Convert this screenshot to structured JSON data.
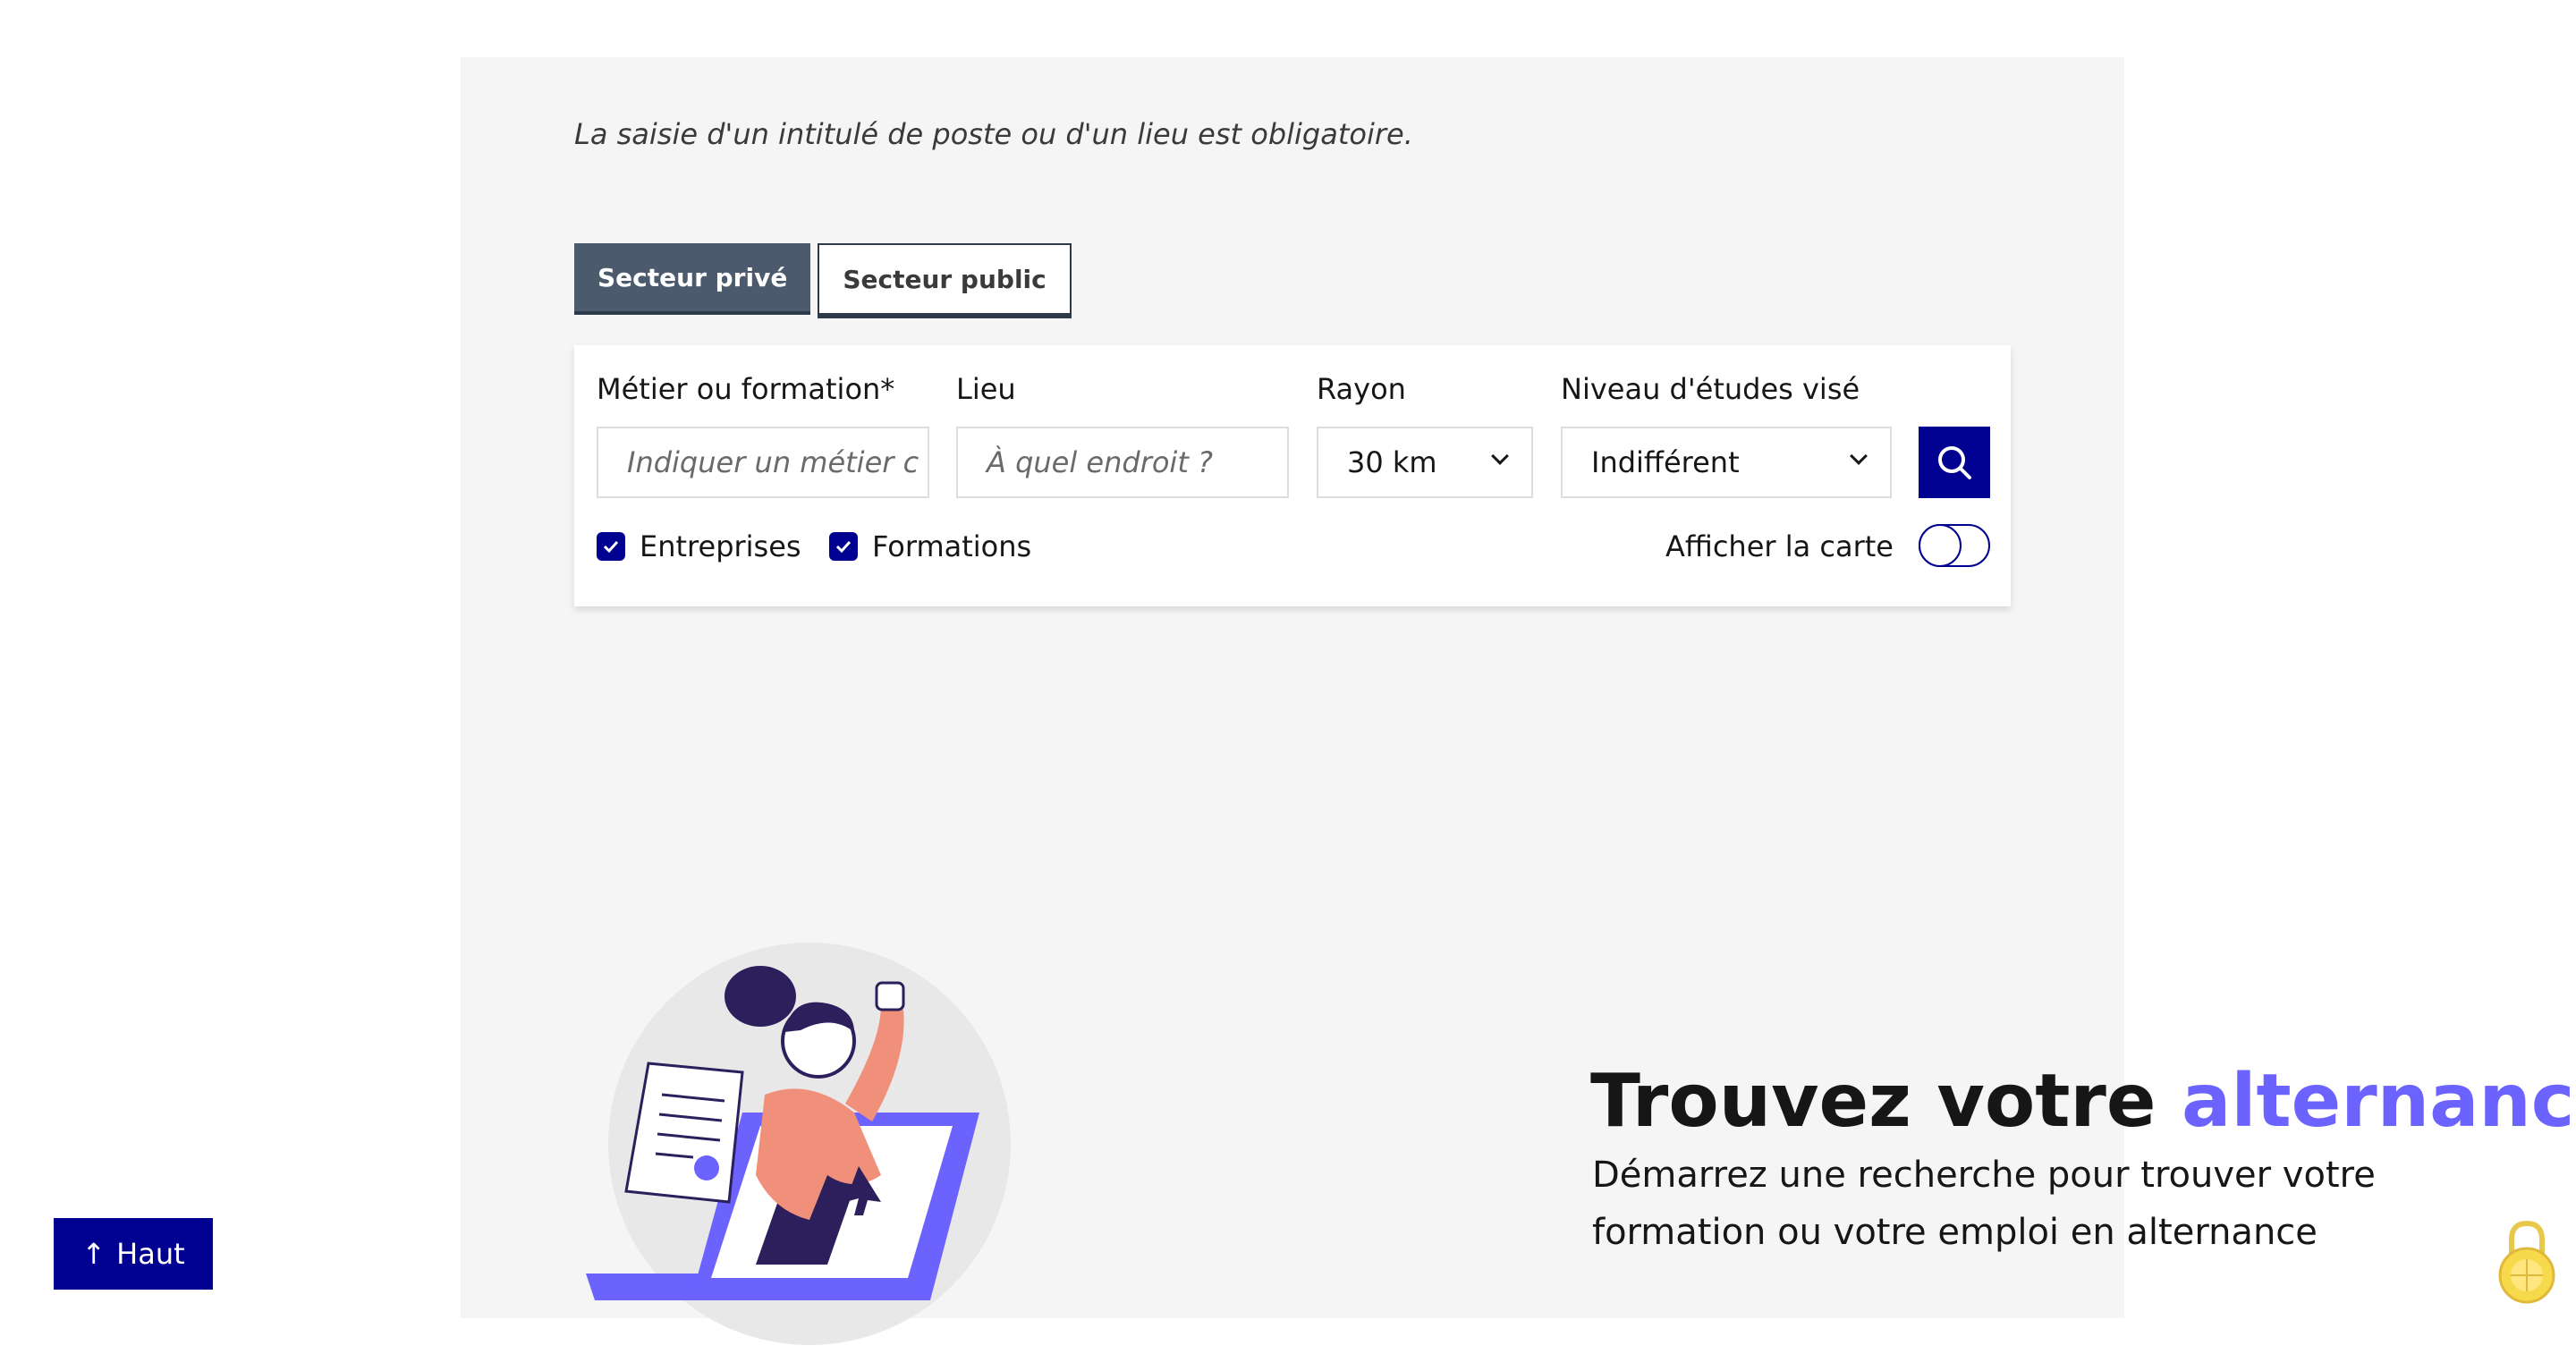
{
  "notice": "La saisie d'un intitulé de poste ou d'un lieu est obligatoire.",
  "tabs": [
    {
      "label": "Secteur privé",
      "active": true
    },
    {
      "label": "Secteur public",
      "active": false
    }
  ],
  "form": {
    "job": {
      "label": "Métier ou formation",
      "required_mark": "*",
      "placeholder": "Indiquer un métier c"
    },
    "place": {
      "label": "Lieu",
      "placeholder": "À quel endroit ?"
    },
    "radius": {
      "label": "Rayon",
      "value": "30 km"
    },
    "level": {
      "label": "Niveau d'études visé",
      "value": "Indifférent"
    },
    "checks": [
      {
        "label": "Entreprises",
        "checked": true
      },
      {
        "label": "Formations",
        "checked": true
      }
    ],
    "map_toggle": {
      "label": "Afficher la carte",
      "on": false
    }
  },
  "hero": {
    "title_start": "Trouvez votre ",
    "title_accent": "alternance",
    "subtitle": "Démarrez une recherche pour trouver votre formation ou votre emploi en alternance"
  },
  "back_to_top": {
    "arrow": "↑",
    "label": "Haut"
  },
  "colors": {
    "primary": "#000091",
    "accent": "#6c63ff",
    "panel": "#f5f5f5",
    "tab_active": "#4b5a6d",
    "salmon": "#f0907a"
  }
}
